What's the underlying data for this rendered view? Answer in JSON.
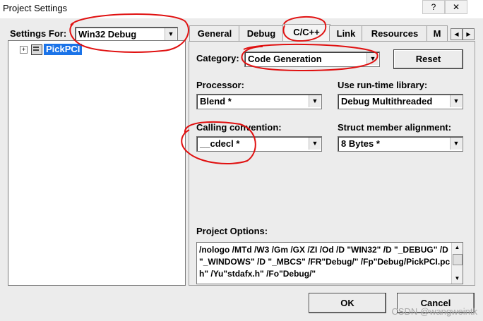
{
  "window": {
    "title": "Project Settings"
  },
  "settings_for": {
    "label": "Settings For:",
    "value": "Win32 Debug"
  },
  "tree": {
    "root_label": "PickPCI"
  },
  "tabs": [
    {
      "label": "General"
    },
    {
      "label": "Debug"
    },
    {
      "label": "C/C++"
    },
    {
      "label": "Link"
    },
    {
      "label": "Resources"
    },
    {
      "label": "M"
    }
  ],
  "category": {
    "label": "Category:",
    "value": "Code Generation"
  },
  "reset_button": {
    "label": "Reset"
  },
  "processor": {
    "label": "Processor:",
    "value": "Blend *"
  },
  "runtime_library": {
    "label": "Use run-time library:",
    "value": "Debug Multithreaded"
  },
  "calling_convention": {
    "label": "Calling convention:",
    "value": "__cdecl *"
  },
  "struct_alignment": {
    "label": "Struct member alignment:",
    "value": "8 Bytes *"
  },
  "project_options": {
    "label": "Project Options:",
    "text": "/nologo /MTd /W3 /Gm /GX /ZI /Od /D \"WIN32\" /D \"_DEBUG\" /D \"_WINDOWS\" /D \"_MBCS\" /FR\"Debug/\" /Fp\"Debug/PickPCI.pch\" /Yu\"stdafx.h\" /Fo\"Debug/\""
  },
  "buttons": {
    "ok": "OK",
    "cancel": "Cancel"
  },
  "watermark": "CSDN @wangweintk",
  "colors": {
    "annotation": "#e01010",
    "selection": "#1a73e8"
  }
}
